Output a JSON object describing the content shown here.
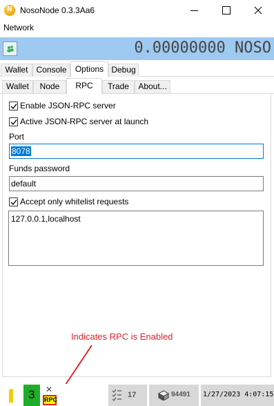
{
  "window": {
    "title": "NosoNode 0.3.3Aa6",
    "app_icon_letter": "N"
  },
  "menu": {
    "items": [
      "Network"
    ]
  },
  "header": {
    "balance": "0.00000000 NOSO",
    "accent_color": "#9ec9f0"
  },
  "tabs": {
    "main": [
      {
        "label": "Wallet",
        "active": false
      },
      {
        "label": "Console",
        "active": false
      },
      {
        "label": "Options",
        "active": true
      },
      {
        "label": "Debug",
        "active": false
      }
    ],
    "options_sub": [
      {
        "label": "Wallet",
        "active": false
      },
      {
        "label": "Node",
        "active": false
      },
      {
        "label": "RPC",
        "active": true
      },
      {
        "label": "Trade",
        "active": false
      },
      {
        "label": "About...",
        "active": false
      }
    ]
  },
  "rpc": {
    "enable_label": "Enable JSON-RPC server",
    "enable_checked": true,
    "active_launch_label": "Active JSON-RPC server at launch",
    "active_launch_checked": true,
    "port_label": "Port",
    "port_value": "8078",
    "funds_password_label": "Funds password",
    "funds_password_value": "default",
    "whitelist_only_label": "Accept only whitelist requests",
    "whitelist_only_checked": true,
    "whitelist_value": "127.0.0.1,localhost"
  },
  "annotation": {
    "text": "Indicates RPC is Enabled",
    "color": "#e0242c"
  },
  "statusbar": {
    "connections": "3",
    "rpc_badge": "RPC",
    "pending_tasks": "17",
    "block_number": "94491",
    "datetime": "1/27/2023 4:07:15"
  }
}
